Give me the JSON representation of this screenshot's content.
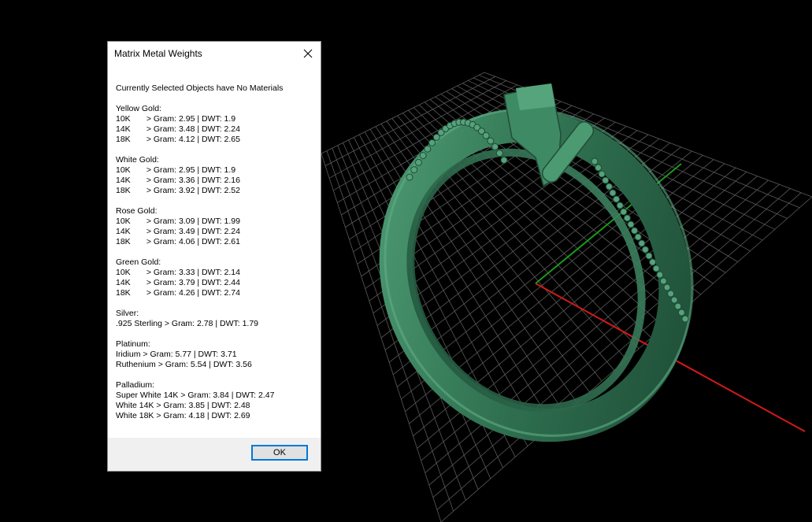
{
  "dialog": {
    "title": "Matrix Metal Weights",
    "message": "Currently Selected Objects have No Materials",
    "ok_label": "OK",
    "groups": [
      {
        "name": "Yellow Gold:",
        "rows": [
          {
            "grade": "10K",
            "text": "  > Gram: 2.95 | DWT: 1.9"
          },
          {
            "grade": "14K",
            "text": "  > Gram: 3.48 | DWT: 2.24"
          },
          {
            "grade": "18K",
            "text": "  > Gram: 4.12 | DWT: 2.65"
          }
        ]
      },
      {
        "name": "White Gold:",
        "rows": [
          {
            "grade": "10K",
            "text": "  > Gram: 2.95 | DWT: 1.9"
          },
          {
            "grade": "14K",
            "text": "  > Gram: 3.36 | DWT: 2.16"
          },
          {
            "grade": "18K",
            "text": "  > Gram: 3.92 | DWT: 2.52"
          }
        ]
      },
      {
        "name": "Rose Gold:",
        "rows": [
          {
            "grade": "10K",
            "text": "  > Gram: 3.09 | DWT: 1.99"
          },
          {
            "grade": "14K",
            "text": "  > Gram: 3.49 | DWT: 2.24"
          },
          {
            "grade": "18K",
            "text": "  > Gram: 4.06 | DWT: 2.61"
          }
        ]
      },
      {
        "name": "Green Gold:",
        "rows": [
          {
            "grade": "10K",
            "text": "  > Gram: 3.33 | DWT: 2.14"
          },
          {
            "grade": "14K",
            "text": "  > Gram: 3.79 | DWT: 2.44"
          },
          {
            "grade": "18K",
            "text": "  > Gram: 4.26 | DWT: 2.74"
          }
        ]
      },
      {
        "name": "Silver:",
        "rows": [
          {
            "grade": "",
            "text": ".925 Sterling > Gram: 2.78 | DWT: 1.79"
          }
        ]
      },
      {
        "name": "Platinum:",
        "rows": [
          {
            "grade": "",
            "text": "Iridium > Gram: 5.77 | DWT: 3.71"
          },
          {
            "grade": "",
            "text": "Ruthenium > Gram: 5.54 | DWT: 3.56"
          }
        ]
      },
      {
        "name": "Palladium:",
        "rows": [
          {
            "grade": "",
            "text": "Super White 14K > Gram: 3.84 | DWT: 2.47"
          },
          {
            "grade": "",
            "text": "White 14K > Gram: 3.85 | DWT: 2.48"
          },
          {
            "grade": "",
            "text": "White 18K > Gram: 4.18 | DWT: 2.69"
          }
        ]
      }
    ]
  },
  "viewport": {
    "background": "#000000",
    "grid_color": "#5a5a5a",
    "x_axis_color": "#d11a1a",
    "y_axis_color": "#1a9a1a",
    "model_color": "#2e6e4e",
    "model_highlight": "#4a9a72",
    "model_shadow": "#1c4a33",
    "model_name": "ring-model"
  },
  "icons": {
    "close": "close-icon"
  }
}
